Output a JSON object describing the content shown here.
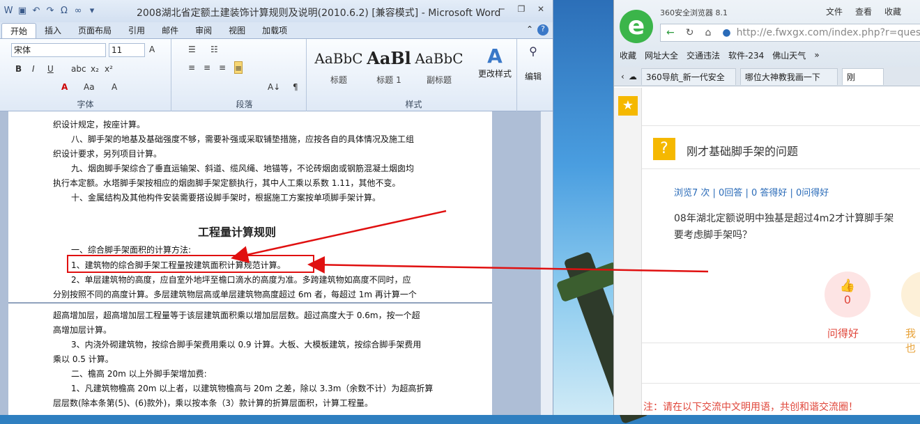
{
  "word": {
    "title": "2008湖北省定额土建装饰计算规则及说明(2010.6.2) [兼容模式] - Microsoft Word",
    "tabs": [
      "开始",
      "插入",
      "页面布局",
      "引用",
      "邮件",
      "审阅",
      "视图",
      "加载项"
    ],
    "font_name": "宋体",
    "font_size": "11",
    "groups": {
      "font": "字体",
      "paragraph": "段落",
      "styles": "样式"
    },
    "styles": [
      {
        "sample": "AaBbC",
        "label": "标题"
      },
      {
        "sample": "AaBl",
        "label": "标题 1"
      },
      {
        "sample": "AaBbC",
        "label": "副标题"
      }
    ],
    "change_styles": "更改样式",
    "edit": "编辑",
    "doc_lines": [
      "织设计规定，按座计算。",
      "八、脚手架的地基及基础强度不够，需要补强或采取铺垫措施，应按各自的具体情况及施工组",
      "织设计要求，另列项目计算。",
      "九、烟囱脚手架综合了垂直运输架、斜道、缆风绳、地锚等，不论砖烟囱或钢筋混凝土烟囱均",
      "执行本定额。水塔脚手架按相应的烟囱脚手架定额执行，其中人工乘以系数 1.11，其他不变。",
      "十、金属结构及其他构件安装需要搭设脚手架时，根据施工方案按单项脚手架计算。"
    ],
    "heading": "工程量计算规则",
    "doc_lines2": [
      "一、综合脚手架面积的计算方法:",
      "1、建筑物的综合脚手架工程量按建筑面积计算规范计算。",
      "2、单层建筑物的高度，应自室外地坪至檐口滴水的高度为准。多跨建筑物如高度不同时，应",
      "分别按照不同的高度计算。多层建筑物层高或单层建筑物高度超过 6m 者，每超过 1m 再计算一个"
    ],
    "doc_lines3": [
      "超高增加层，超高增加层工程量等于该层建筑面积乘以增加层层数。超过高度大于 0.6m，按一个超",
      "高增加层计算。",
      "3、内浇外砌建筑物，按综合脚手架费用乘以 0.9 计算。大板、大模板建筑，按综合脚手架费用",
      "乘以 0.5 计算。",
      "二、檐高 20m 以上外脚手架增加费:",
      "1、凡建筑物檐高 20m 以上者，以建筑物檐高与 20m 之差，除以 3.3m（余数不计）为超高折算",
      "层层数(除本条第(5)、(6)款外)，乘以按本条（3）款计算的折算层面积，计算工程量。"
    ]
  },
  "browser": {
    "title": "360安全浏览器 8.1",
    "menu": [
      "文件",
      "查看",
      "收藏"
    ],
    "url": "http://e.fwxgx.com/index.php?r=quest",
    "bookmarks": [
      "收藏",
      "网址大全",
      "交通违法",
      "软件-234",
      "佛山天气"
    ],
    "tabs": [
      "360导航_新一代安全",
      "哪位大神教我画一下",
      "刚"
    ],
    "question_title": "刚才基础脚手架的问题",
    "stats": "浏览7 次 | 0回答 | 0 答得好 | 0问得好",
    "question_body_1": "08年湖北定额说明中独基是超过4m2才计算脚手架",
    "question_body_2": "要考虑脚手架吗？",
    "like_count": "0",
    "like_label": "问得好",
    "like2_label": "我也",
    "notice": "注：请在以下交流中文明用语，共创和谐交流圈！"
  },
  "colors": {
    "annotation": "#e01010",
    "accent": "#2a6bb8",
    "warn": "#f5b800"
  }
}
